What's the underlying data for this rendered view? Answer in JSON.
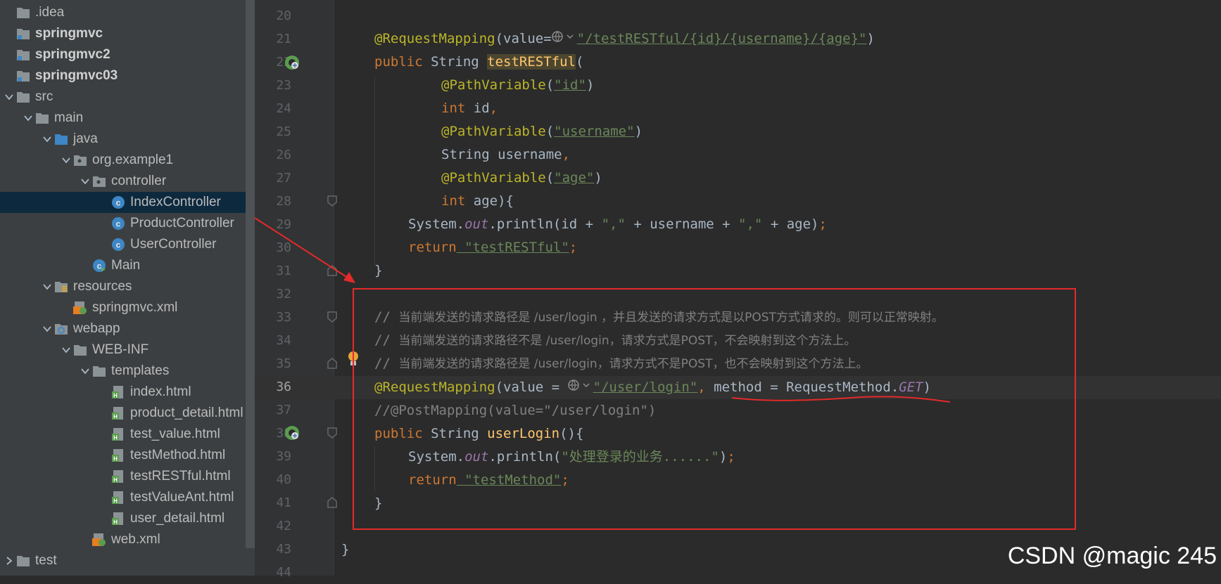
{
  "project_tree": {
    "items": [
      {
        "label": ".idea",
        "arrow": "",
        "icon": "folder",
        "indent": 0,
        "bold": false
      },
      {
        "label": "springmvc",
        "arrow": "",
        "icon": "module",
        "indent": 0,
        "bold": true
      },
      {
        "label": "springmvc2",
        "arrow": "",
        "icon": "module",
        "indent": 0,
        "bold": true
      },
      {
        "label": "springmvc03",
        "arrow": "",
        "icon": "module",
        "indent": 0,
        "bold": true
      },
      {
        "label": "src",
        "arrow": "down",
        "icon": "folder",
        "indent": 0,
        "bold": false
      },
      {
        "label": "main",
        "arrow": "down",
        "icon": "folder",
        "indent": 1,
        "bold": false
      },
      {
        "label": "java",
        "arrow": "down",
        "icon": "folder-blue",
        "indent": 2,
        "bold": false
      },
      {
        "label": "org.example1",
        "arrow": "down",
        "icon": "package",
        "indent": 3,
        "bold": false
      },
      {
        "label": "controller",
        "arrow": "down",
        "icon": "package",
        "indent": 4,
        "bold": false
      },
      {
        "label": "IndexController",
        "arrow": "",
        "icon": "class",
        "indent": 5,
        "bold": false,
        "selected": true
      },
      {
        "label": "ProductController",
        "arrow": "",
        "icon": "class",
        "indent": 5,
        "bold": false
      },
      {
        "label": "UserController",
        "arrow": "",
        "icon": "class",
        "indent": 5,
        "bold": false
      },
      {
        "label": "Main",
        "arrow": "",
        "icon": "class-run",
        "indent": 4,
        "bold": false
      },
      {
        "label": "resources",
        "arrow": "down",
        "icon": "folder-res",
        "indent": 2,
        "bold": false
      },
      {
        "label": "springmvc.xml",
        "arrow": "",
        "icon": "xml",
        "indent": 3,
        "bold": false
      },
      {
        "label": "webapp",
        "arrow": "down",
        "icon": "folder-web",
        "indent": 2,
        "bold": false
      },
      {
        "label": "WEB-INF",
        "arrow": "down",
        "icon": "folder",
        "indent": 3,
        "bold": false
      },
      {
        "label": "templates",
        "arrow": "down",
        "icon": "folder",
        "indent": 4,
        "bold": false
      },
      {
        "label": "index.html",
        "arrow": "",
        "icon": "html",
        "indent": 5,
        "bold": false
      },
      {
        "label": "product_detail.html",
        "arrow": "",
        "icon": "html",
        "indent": 5,
        "bold": false
      },
      {
        "label": "test_value.html",
        "arrow": "",
        "icon": "html",
        "indent": 5,
        "bold": false
      },
      {
        "label": "testMethod.html",
        "arrow": "",
        "icon": "html",
        "indent": 5,
        "bold": false
      },
      {
        "label": "testRESTful.html",
        "arrow": "",
        "icon": "html",
        "indent": 5,
        "bold": false
      },
      {
        "label": "testValueAnt.html",
        "arrow": "",
        "icon": "html",
        "indent": 5,
        "bold": false
      },
      {
        "label": "user_detail.html",
        "arrow": "",
        "icon": "html",
        "indent": 5,
        "bold": false
      },
      {
        "label": "web.xml",
        "arrow": "",
        "icon": "xml",
        "indent": 4,
        "bold": false
      },
      {
        "label": "test",
        "arrow": "right",
        "icon": "folder",
        "indent": 0,
        "bold": false
      }
    ]
  },
  "editor": {
    "current_line": "36",
    "line_numbers": [
      "20",
      "21",
      "22",
      "23",
      "24",
      "25",
      "26",
      "27",
      "28",
      "29",
      "30",
      "31",
      "32",
      "33",
      "34",
      "35",
      "36",
      "37",
      "38",
      "39",
      "40",
      "41",
      "42",
      "43",
      "44"
    ],
    "code": {
      "l21_ann": "@RequestMapping",
      "l21_a": "(value=",
      "l21_str": "\"/testRESTful/{id}/{username}/{age}\"",
      "l21_b": ")",
      "l22_kw": "public",
      "l22_type": " String ",
      "l22_fn": "testRESTful",
      "l22_b": "(",
      "l23_ann": "@PathVariable",
      "l23_a": "(",
      "l23_str": "\"id\"",
      "l23_b": ")",
      "l24_kw": "int",
      "l24_a": " id",
      "l24_c": ",",
      "l25_ann": "@PathVariable",
      "l25_a": "(",
      "l25_str": "\"username\"",
      "l25_b": ")",
      "l26_a": "String username",
      "l26_c": ",",
      "l27_ann": "@PathVariable",
      "l27_a": "(",
      "l27_str": "\"age\"",
      "l27_b": ")",
      "l28_kw": "int",
      "l28_a": " age){",
      "l29_a": "System.",
      "l29_fld": "out",
      "l29_b": ".println(id + ",
      "l29_s1": "\",\"",
      "l29_c": " + username + ",
      "l29_s2": "\",\"",
      "l29_d": " + age)",
      "l29_e": ";",
      "l30_kw": "return",
      "l30_str": " \"testRESTful\"",
      "l30_e": ";",
      "l31": "}",
      "l33_a": "// ",
      "l33_cn": "当前端发送的请求路径是 /user/login ，并且发送的请求方式是以POST方式请求的。则可以正常映射。",
      "l34_a": "// ",
      "l34_cn": "当前端发送的请求路径不是 /user/login，请求方式是POST，不会映射到这个方法上。",
      "l35_a": "// ",
      "l35_cn": "当前端发送的请求路径是 /user/login，请求方式不是POST，也不会映射到这个方法上。",
      "l36_ann": "@RequestMapping",
      "l36_a": "(value = ",
      "l36_str": "\"/user/login\"",
      "l36_c": ", ",
      "l36_d": "method = RequestMethod.",
      "l36_fld": "GET",
      "l36_e": ")",
      "l37": "//@PostMapping(value=\"/user/login\")",
      "l38_kw": "public",
      "l38_type": " String ",
      "l38_fn": "userLogin",
      "l38_b": "(){",
      "l39_a": "System.",
      "l39_fld": "out",
      "l39_b": ".println(",
      "l39_str": "\"处理登录的业务......\"",
      "l39_c": ")",
      "l39_e": ";",
      "l40_kw": "return",
      "l40_str": " \"testMethod\"",
      "l40_e": ";",
      "l41": "}",
      "l43": "}"
    }
  },
  "watermark": "CSDN @magic 245"
}
